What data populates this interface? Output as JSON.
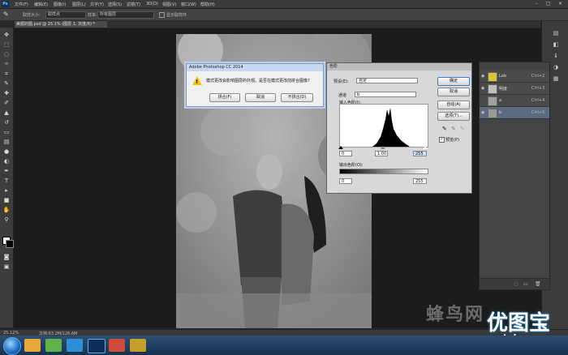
{
  "menubar": {
    "logo": "Ps",
    "items": [
      "文件(F)",
      "编辑(E)",
      "图像(I)",
      "图层(L)",
      "文字(Y)",
      "选择(S)",
      "滤镜(T)",
      "3D(D)",
      "视图(V)",
      "窗口(W)",
      "帮助(H)"
    ],
    "window_controls": [
      "–",
      "□",
      "✕"
    ]
  },
  "options_bar": {
    "sample_size_label": "取样大小:",
    "sample_size_value": "取样点",
    "sample_label": "样本:",
    "sample_value": "所有图层",
    "show_ring_label": "显示取样环"
  },
  "document_tab": {
    "title": "美顺的图.psd @ 25.1% (图层 1, 灰度/8) *"
  },
  "status": {
    "zoom": "25.12%",
    "doc_info": "文档:63.2M/126.6M"
  },
  "warning_dialog": {
    "title": "Adobe Photoshop CC 2014",
    "message": "模式更改会影响图层的外观。是否在模式更改前拼合图像?",
    "buttons": [
      "拼合(F)",
      "取消",
      "不拼合(D)"
    ]
  },
  "levels_dialog": {
    "title": "色阶",
    "preset_label": "预设(E):",
    "preset_value": "自定",
    "channel_label": "通道",
    "channel_value": "b",
    "input_label": "输入色阶(I):",
    "input_values": [
      "0",
      "1.00",
      "255"
    ],
    "output_label": "输出色阶(O):",
    "output_values": [
      "0",
      "255"
    ],
    "buttons": [
      "确定",
      "取消",
      "自动(A)",
      "选项(T)..."
    ],
    "preview_label": "预览(P)"
  },
  "layers_panel": {
    "layers": [
      {
        "name": "Lab",
        "shortcut": "Ctrl+2",
        "thumb": "#d7c53a"
      },
      {
        "name": "明度",
        "shortcut": "Ctrl+3",
        "thumb": "#bdbdbd"
      },
      {
        "name": "a",
        "shortcut": "Ctrl+4",
        "thumb": "#a0a0a0"
      },
      {
        "name": "b",
        "shortcut": "Ctrl+5",
        "thumb": "#9a9a9a"
      }
    ]
  },
  "watermark": {
    "site_cn": "蜂鸟网",
    "brand": "优图宝",
    "domain": "utobao.com"
  }
}
